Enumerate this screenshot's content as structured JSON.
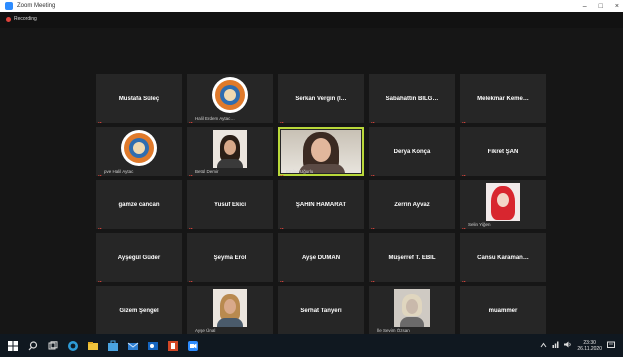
{
  "window": {
    "title": "Zoom Meeting",
    "controls": [
      "–",
      "□",
      "×"
    ]
  },
  "recording": {
    "label": "Recording"
  },
  "participants": [
    {
      "name": "Mustafa Süleç",
      "kind": "name"
    },
    {
      "name": "",
      "kind": "logo",
      "caption": "Halil Erdem Aytac…"
    },
    {
      "name": "Serkan Vergin (İ…",
      "kind": "name"
    },
    {
      "name": "Sabahattin BİLG…",
      "kind": "name"
    },
    {
      "name": "Melekmar Keme…",
      "kind": "name"
    },
    {
      "name": "",
      "kind": "logo",
      "caption": "pve Halil Aytac"
    },
    {
      "name": "",
      "kind": "photo",
      "caption": "Betül Demir"
    },
    {
      "name": "",
      "kind": "video",
      "caption": "Emine Uğurlu"
    },
    {
      "name": "Derya Konça",
      "kind": "name"
    },
    {
      "name": "Fikret ŞAN",
      "kind": "name"
    },
    {
      "name": "gamze cancan",
      "kind": "name"
    },
    {
      "name": "Yusuf Ekici",
      "kind": "name"
    },
    {
      "name": "ŞAHİN HAMARAT",
      "kind": "name"
    },
    {
      "name": "Zerrin Ayvaz",
      "kind": "name"
    },
    {
      "name": "",
      "kind": "cartoon",
      "caption": "Selin Yiğen"
    },
    {
      "name": "Ayşegül Güder",
      "kind": "name"
    },
    {
      "name": "Şeyma Erol",
      "kind": "name"
    },
    {
      "name": "Ayşe DUMAN",
      "kind": "name"
    },
    {
      "name": "Müşerref T. EBİL",
      "kind": "name"
    },
    {
      "name": "Cansu Karaman…",
      "kind": "name"
    },
    {
      "name": "Gizem Şengel",
      "kind": "name"
    },
    {
      "name": "",
      "kind": "photo2",
      "caption": "Ayşe Ünal"
    },
    {
      "name": "Serhat Tanyeri",
      "kind": "name"
    },
    {
      "name": "",
      "kind": "grayphoto",
      "caption": "İle Sevim Özsan"
    },
    {
      "name": "muammer",
      "kind": "name"
    }
  ],
  "taskbar": {
    "icons": [
      "windows-icon",
      "search-icon",
      "task-view-icon",
      "edge-icon",
      "file-explorer-icon",
      "store-icon",
      "mail-icon",
      "outlook-icon",
      "powerpoint-icon",
      "zoom-icon"
    ],
    "time": "23:30",
    "date": "26.11.2020"
  },
  "colors": {
    "active_speaker": "#b9d83a",
    "tile": "#262626",
    "mute": "#d9443a"
  }
}
